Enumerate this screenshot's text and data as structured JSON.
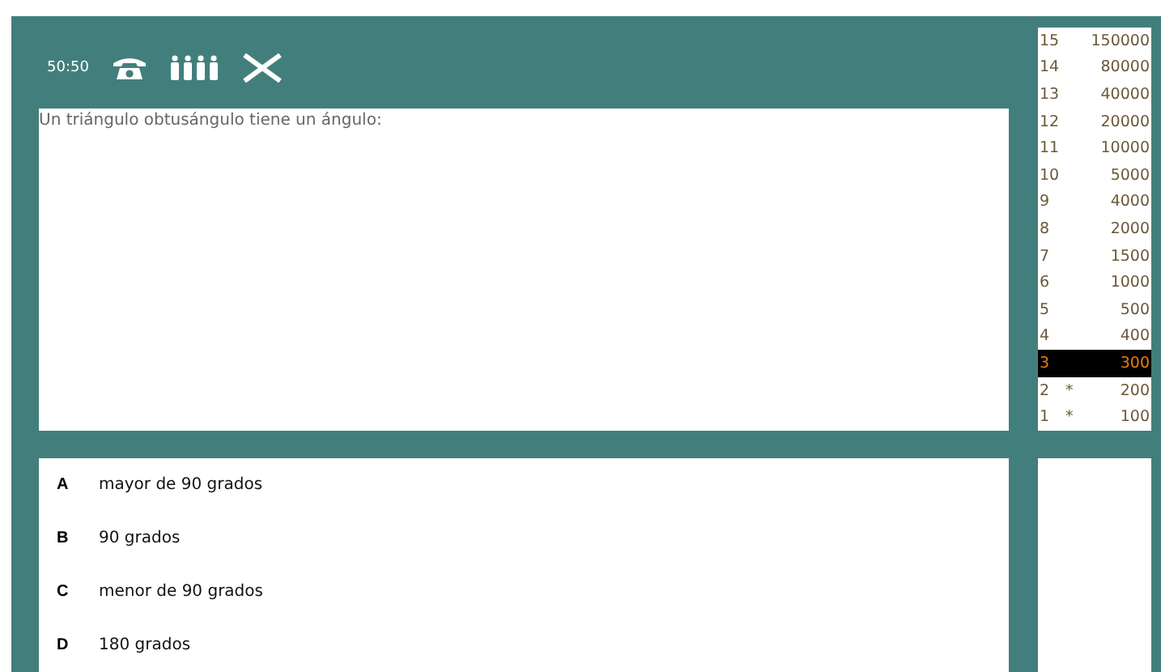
{
  "lifelines": [
    {
      "kind": "text",
      "label": "50:50"
    },
    {
      "kind": "phone"
    },
    {
      "kind": "audience"
    },
    {
      "kind": "cross"
    }
  ],
  "question": "Un triángulo obtusángulo tiene un ángulo:",
  "answers": [
    {
      "letter": "A",
      "text": "mayor de 90 grados"
    },
    {
      "letter": "B",
      "text": "90 grados"
    },
    {
      "letter": "C",
      "text": "menor de 90 grados"
    },
    {
      "letter": "D",
      "text": "180 grados"
    }
  ],
  "prize_ladder": [
    {
      "level": "15",
      "amount": "150000",
      "selected": false
    },
    {
      "level": "14",
      "amount": "80000",
      "selected": false
    },
    {
      "level": "13",
      "amount": "40000",
      "selected": false
    },
    {
      "level": "12",
      "amount": "20000",
      "selected": false
    },
    {
      "level": "11",
      "amount": "10000",
      "selected": false
    },
    {
      "level": "10",
      "amount": "5000",
      "selected": false
    },
    {
      "level": "9",
      "amount": "4000",
      "selected": false
    },
    {
      "level": "8",
      "amount": "2000",
      "selected": false
    },
    {
      "level": "7",
      "amount": "1500",
      "selected": false
    },
    {
      "level": "6",
      "amount": "1000",
      "selected": false
    },
    {
      "level": "5",
      "amount": "500",
      "selected": false
    },
    {
      "level": "4",
      "amount": "400",
      "selected": false
    },
    {
      "level": "3",
      "amount": "300",
      "selected": true
    },
    {
      "level": "2",
      "marker": "*",
      "amount": "200",
      "selected": false
    },
    {
      "level": "1",
      "marker": "*",
      "amount": "100",
      "selected": false
    }
  ]
}
